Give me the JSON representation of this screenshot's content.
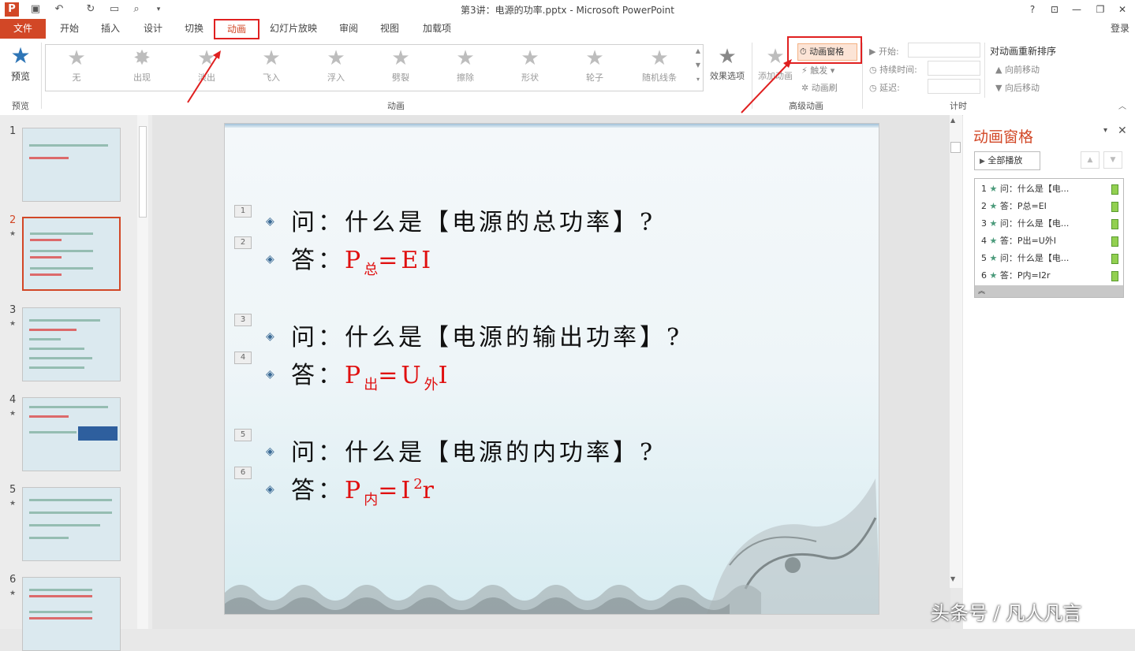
{
  "window": {
    "title": "第3讲：电源的功率.pptx - Microsoft PowerPoint",
    "help": "?",
    "login": "登录"
  },
  "tabs": [
    "文件",
    "开始",
    "插入",
    "设计",
    "切换",
    "动画",
    "幻灯片放映",
    "审阅",
    "视图",
    "加载项"
  ],
  "ribbon": {
    "preview_label": "预览",
    "preview_group": "预览",
    "animations": [
      "无",
      "出现",
      "淡出",
      "飞入",
      "浮入",
      "劈裂",
      "擦除",
      "形状",
      "轮子",
      "随机线条"
    ],
    "effect_options": "效果选项",
    "animation_group": "动画",
    "add_animation": "添加动画",
    "animation_pane": "动画窗格",
    "trigger": "触发",
    "animation_painter": "动画刷",
    "advanced_group": "高级动画",
    "start_label": "开始:",
    "duration_label": "持续时间:",
    "delay_label": "延迟:",
    "reorder_title": "对动画重新排序",
    "move_earlier": "向前移动",
    "move_later": "向后移动",
    "timing_group": "计时"
  },
  "thumbnails": [
    {
      "num": "1",
      "star": ""
    },
    {
      "num": "2",
      "star": "★"
    },
    {
      "num": "3",
      "star": "★"
    },
    {
      "num": "4",
      "star": "★"
    },
    {
      "num": "5",
      "star": "★"
    },
    {
      "num": "6",
      "star": "★"
    }
  ],
  "slide": {
    "tags": [
      "1",
      "2",
      "3",
      "4",
      "5",
      "6"
    ],
    "q1": "问：什么是【电源的总功率】?",
    "a1_prefix": "答：",
    "a1_p": "P",
    "a1_sub": "总",
    "a1_rest": "=EI",
    "q2": "问：什么是【电源的输出功率】?",
    "a2_prefix": "答：",
    "a2_p": "P",
    "a2_sub": "出",
    "a2_mid": "=U",
    "a2_sub2": "外",
    "a2_rest": "I",
    "q3": "问：什么是【电源的内功率】?",
    "a3_prefix": "答：",
    "a3_p": "P",
    "a3_sub": "内",
    "a3_mid": "=I",
    "a3_sup": "2",
    "a3_rest": "r"
  },
  "anim_pane": {
    "title": "动画窗格",
    "play_all": "全部播放",
    "items": [
      {
        "num": "1",
        "label": "问：什么是【电..."
      },
      {
        "num": "2",
        "label": "答：P总=EI"
      },
      {
        "num": "3",
        "label": "问：什么是【电..."
      },
      {
        "num": "4",
        "label": "答：P出=U外I"
      },
      {
        "num": "5",
        "label": "问：什么是【电..."
      },
      {
        "num": "6",
        "label": "答：P内=I2r"
      }
    ]
  },
  "watermark": "头条号 / 凡人凡言"
}
